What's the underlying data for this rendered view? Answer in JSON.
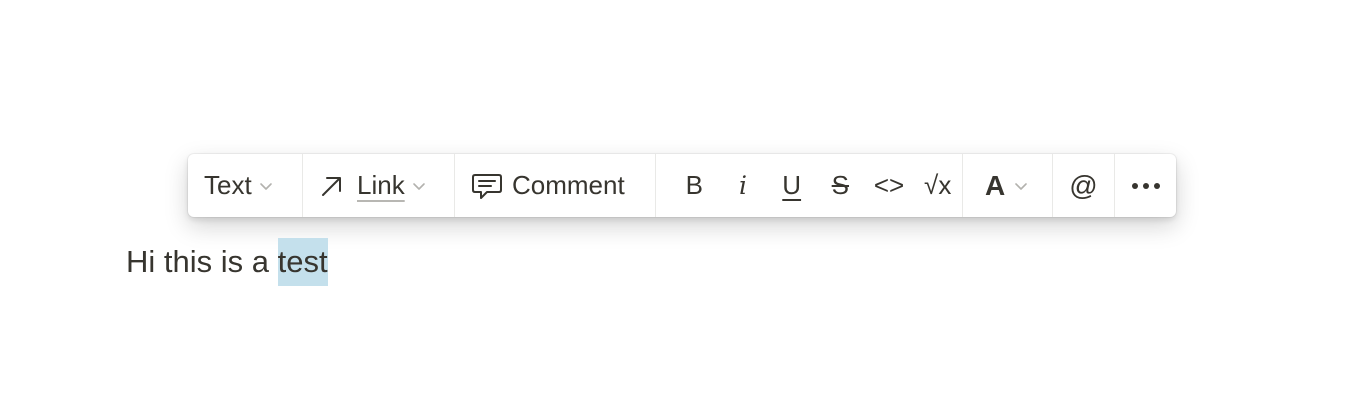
{
  "toolbar": {
    "block_type": {
      "label": "Text",
      "icon": "chevron-down-icon"
    },
    "link": {
      "label": "Link",
      "icon": "arrow-up-right-icon"
    },
    "comment": {
      "label": "Comment",
      "icon": "comment-icon"
    },
    "format": {
      "bold": "B",
      "italic": "i",
      "underline": "U",
      "strikethrough": "S",
      "code": "<>",
      "equation": "√x"
    },
    "color": {
      "label": "A"
    },
    "mention": {
      "label": "@"
    },
    "more": {
      "icon": "more-icon"
    }
  },
  "content": {
    "text_before": "Hi this is a ",
    "selected_text": "test",
    "selection_color": "#c4e0ec"
  }
}
